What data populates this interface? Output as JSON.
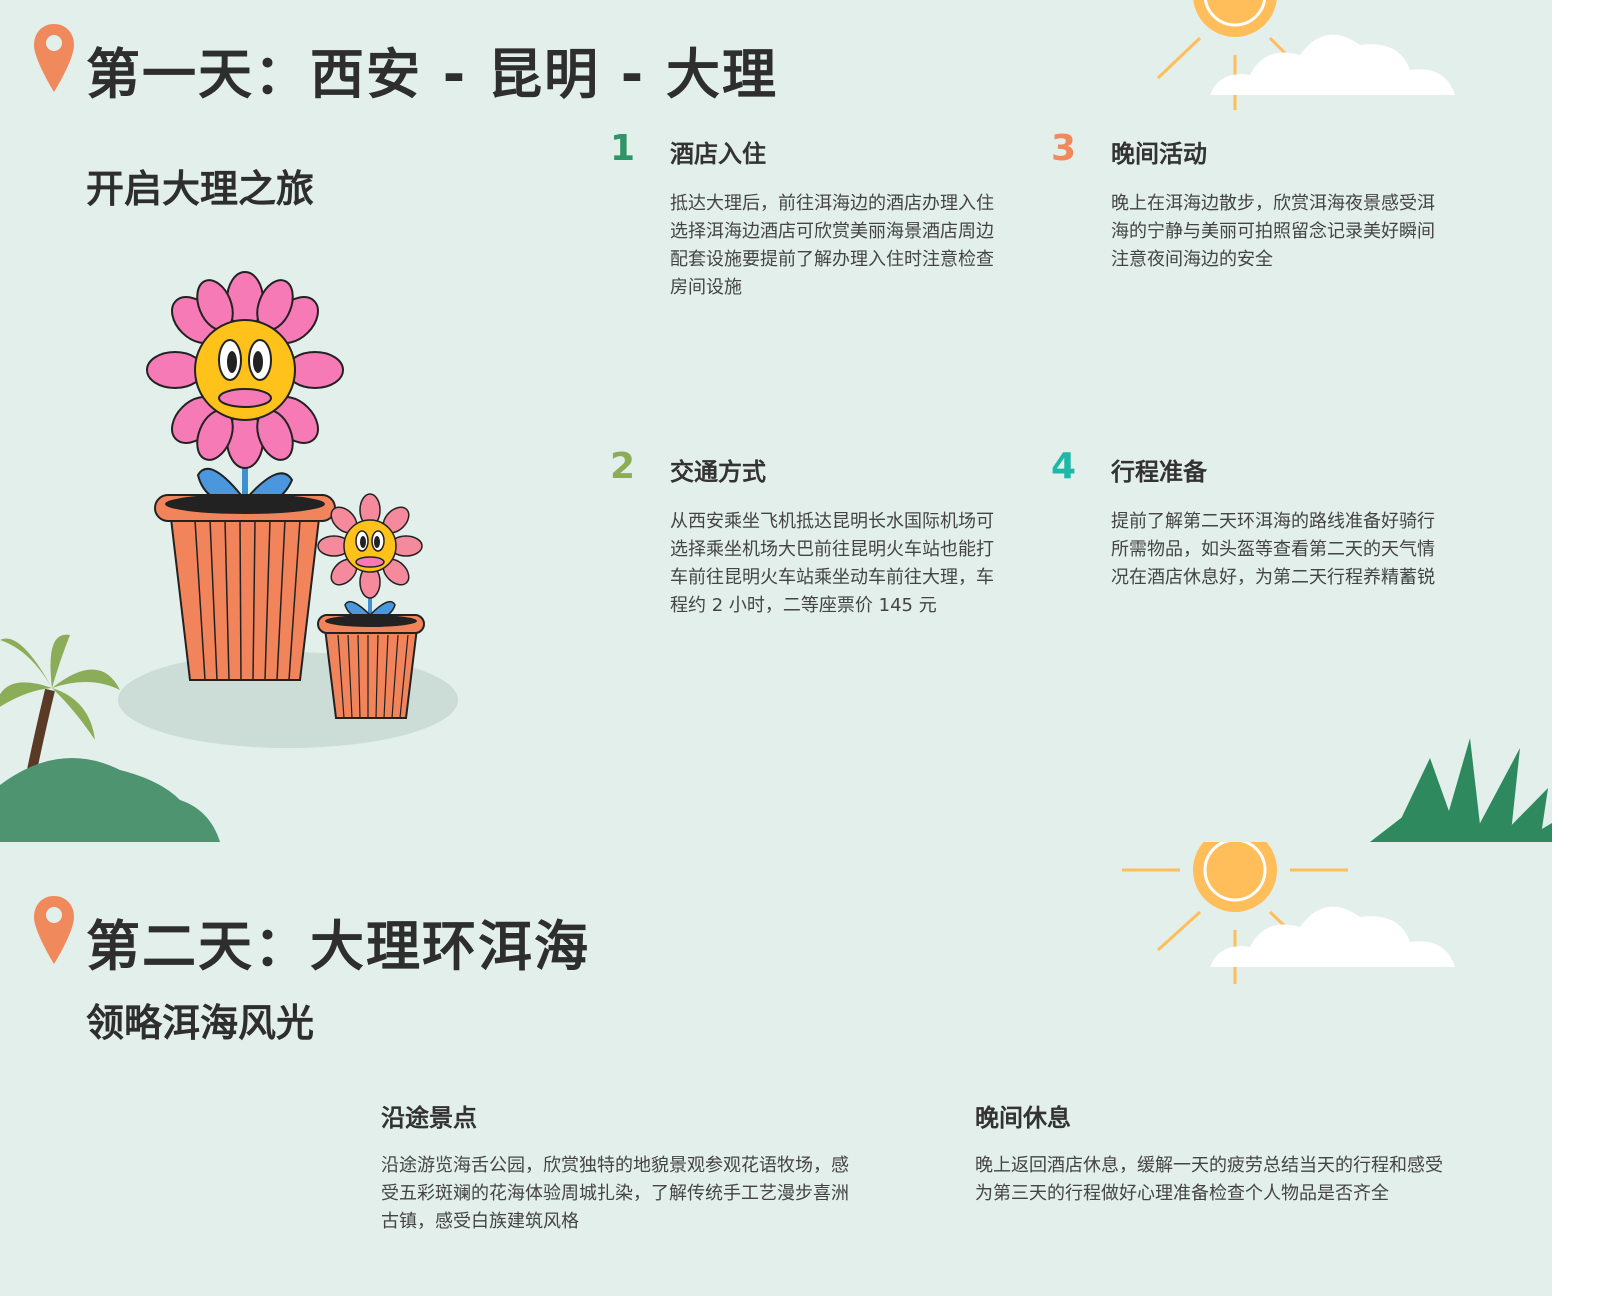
{
  "colors": {
    "background": "#e3efea",
    "title": "#2e2e2e",
    "pin": "#f08a5d",
    "num1": "#2f9466",
    "num2": "#8cad58",
    "num3": "#f08a5d",
    "num4": "#1fb8a8",
    "sun": "#ffbe5a",
    "petal": "#f67ab6",
    "pot": "#f2845c",
    "dark_green": "#4f9470"
  },
  "day1": {
    "title": "第一天：西安 - 昆明 - 大理",
    "subtitle": "开启大理之旅",
    "items": [
      {
        "num": "1",
        "title": "酒店入住",
        "text": "抵达大理后，前往洱海边的酒店办理入住选择洱海边酒店可欣赏美丽海景酒店周边配套设施要提前了解办理入住时注意检查房间设施"
      },
      {
        "num": "2",
        "title": "交通方式",
        "text": "从西安乘坐飞机抵达昆明长水国际机场可选择乘坐机场大巴前往昆明火车站也能打车前往昆明火车站乘坐动车前往大理，车程约 2 小时，二等座票价 145 元"
      },
      {
        "num": "3",
        "title": "晚间活动",
        "text": "晚上在洱海边散步，欣赏洱海夜景感受洱海的宁静与美丽可拍照留念记录美好瞬间注意夜间海边的安全"
      },
      {
        "num": "4",
        "title": "行程准备",
        "text": "提前了解第二天环洱海的路线准备好骑行所需物品，如头盔等查看第二天的天气情况在酒店休息好，为第二天行程养精蓄锐"
      }
    ]
  },
  "day2": {
    "title": "第二天：大理环洱海",
    "subtitle": "领略洱海风光",
    "items": [
      {
        "title": "沿途景点",
        "text": "沿途游览海舌公园，欣赏独特的地貌景观参观花语牧场，感受五彩斑斓的花海体验周城扎染，了解传统手工艺漫步喜洲古镇，感受白族建筑风格"
      },
      {
        "title": "晚间休息",
        "text": "晚上返回酒店休息，缓解一天的疲劳总结当天的行程和感受为第三天的行程做好心理准备检查个人物品是否齐全"
      }
    ]
  },
  "icons": {
    "pin": "location-pin-icon",
    "sun": "sun-icon",
    "cloud": "cloud-icon",
    "flower": "flower-pot-illustration",
    "palm": "palm-tree-icon",
    "fan_leaf": "fan-leaf-icon"
  }
}
